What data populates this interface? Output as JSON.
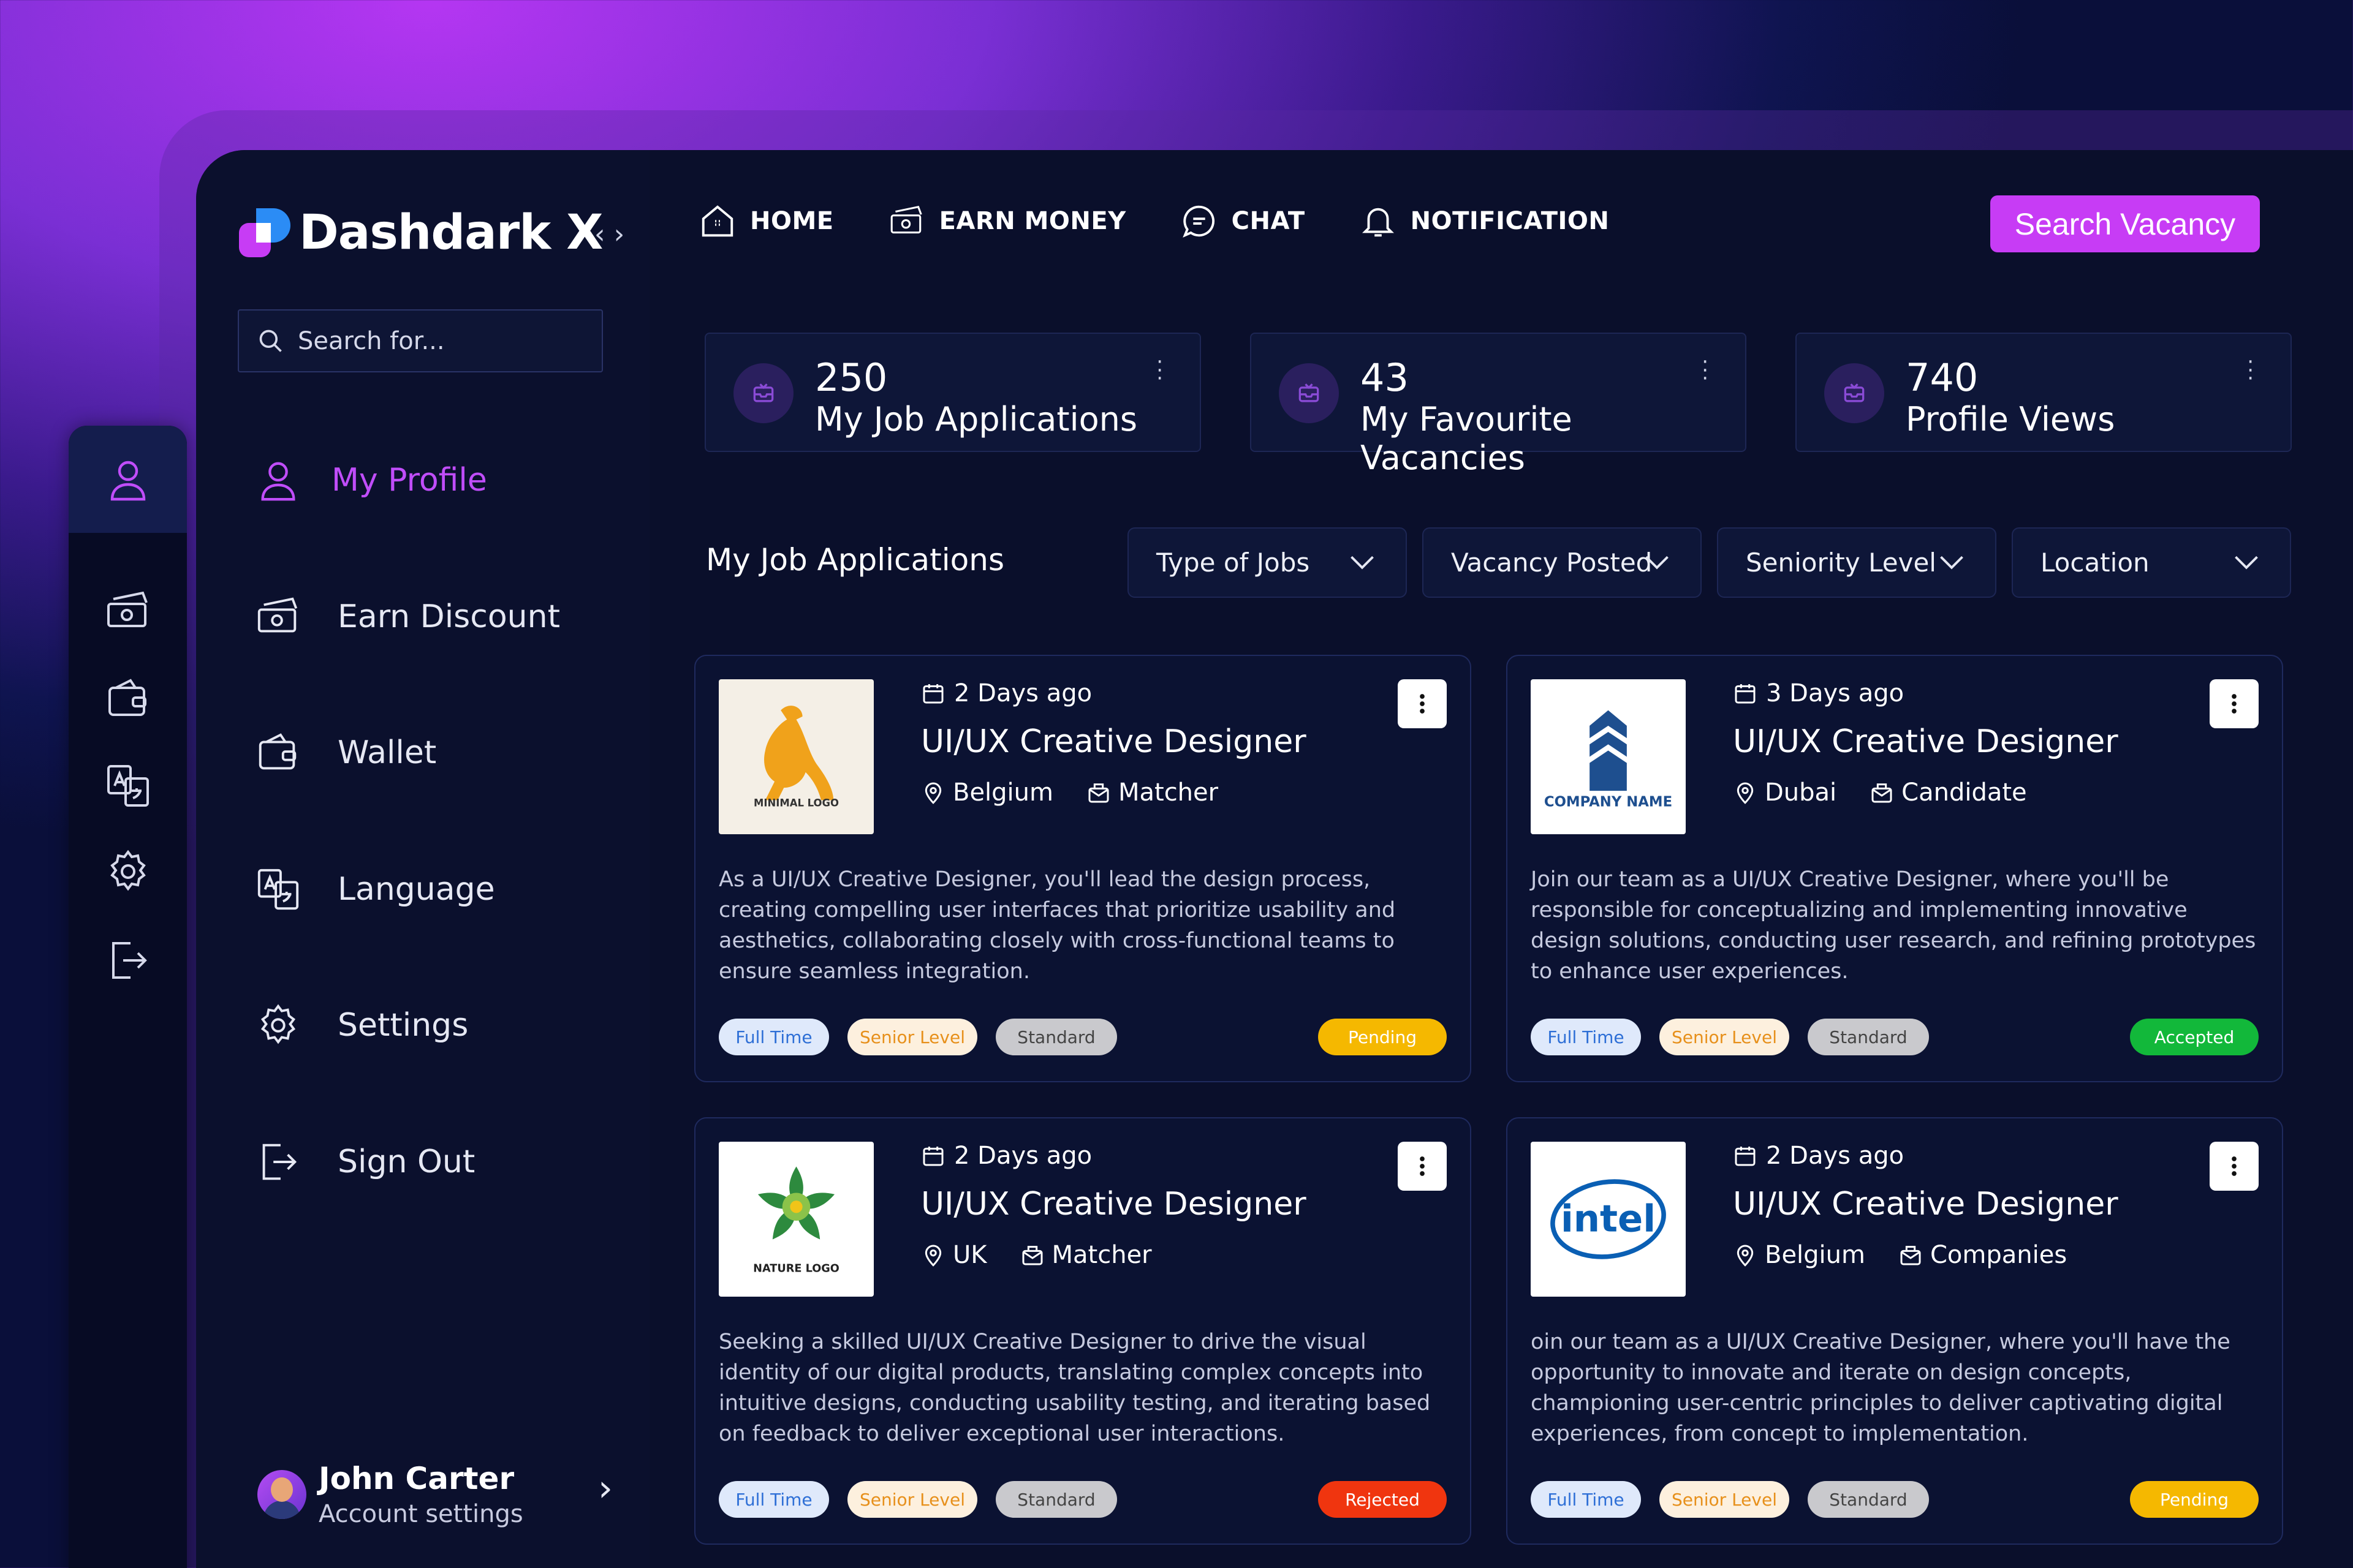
{
  "brand": {
    "name": "Dashdark X",
    "collapse_icon": "code-brackets-icon"
  },
  "search": {
    "placeholder": "Search for..."
  },
  "sidebar": {
    "items": [
      {
        "label": "My Profile",
        "icon": "user-icon",
        "active": true
      },
      {
        "label": "Earn Discount",
        "icon": "money-icon"
      },
      {
        "label": "Wallet",
        "icon": "wallet-icon"
      },
      {
        "label": "Language",
        "icon": "translate-icon"
      },
      {
        "label": "Settings",
        "icon": "gear-icon"
      },
      {
        "label": "Sign Out",
        "icon": "logout-icon"
      }
    ]
  },
  "user": {
    "name": "John Carter",
    "subtitle": "Account settings"
  },
  "topnav": {
    "items": [
      {
        "label": "HOME",
        "icon": "home-icon"
      },
      {
        "label": "EARN MONEY",
        "icon": "money-icon"
      },
      {
        "label": "CHAT",
        "icon": "chat-icon"
      },
      {
        "label": "NOTIFICATION",
        "icon": "bell-icon"
      }
    ],
    "cta": "Search Vacancy"
  },
  "stats": [
    {
      "value": "250",
      "label": "My Job Applications"
    },
    {
      "value": "43",
      "label": "My Favourite Vacancies"
    },
    {
      "value": "740",
      "label": "Profile Views"
    }
  ],
  "section": {
    "title": "My Job Applications"
  },
  "filters": [
    "Type of Jobs",
    "Vacancy Posted",
    "Seniority Level",
    "Location"
  ],
  "jobs": [
    {
      "date": "2 Days ago",
      "title": "UI/UX Creative Designer",
      "location": "Belgium",
      "type": "Matcher",
      "logo_text": "MINIMAL LOGO",
      "description": "As a UI/UX Creative Designer, you'll lead the design process, creating compelling user interfaces that prioritize usability and aesthetics, collaborating closely with cross-functional teams to ensure seamless integration.",
      "tags": [
        "Full Time",
        "Senior Level",
        "Standard"
      ],
      "status": "Pending",
      "status_color": "#f5b800"
    },
    {
      "date": "3 Days ago",
      "title": "UI/UX Creative Designer",
      "location": "Dubai",
      "type": "Candidate",
      "logo_text": "COMPANY NAME",
      "description": "Join our team as a UI/UX Creative Designer, where you'll be responsible for conceptualizing and implementing innovative design solutions, conducting user research, and refining prototypes to enhance user experiences.",
      "tags": [
        "Full Time",
        "Senior Level",
        "Standard"
      ],
      "status": "Accepted",
      "status_color": "#12b83a"
    },
    {
      "date": "2 Days ago",
      "title": "UI/UX Creative Designer",
      "location": "UK",
      "type": "Matcher",
      "logo_text": "NATURE LOGO",
      "description": "Seeking a skilled UI/UX Creative Designer to drive the visual identity of our digital products, translating complex concepts into intuitive designs, conducting usability testing, and iterating based on feedback to deliver exceptional user interactions.",
      "tags": [
        "Full Time",
        "Senior Level",
        "Standard"
      ],
      "status": "Rejected",
      "status_color": "#f0350f"
    },
    {
      "date": "2 Days ago",
      "title": "UI/UX Creative Designer",
      "location": "Belgium",
      "type": "Companies",
      "logo_text": "intel",
      "description": "oin our team as a UI/UX Creative Designer, where you'll have the opportunity to innovate and iterate on design concepts, championing user-centric principles to deliver captivating digital experiences, from concept to implementation.",
      "tags": [
        "Full Time",
        "Senior Level",
        "Standard"
      ],
      "status": "Pending",
      "status_color": "#f5b800"
    }
  ],
  "colors": {
    "accent": "#c73cf5",
    "background": "#0a0f2b",
    "panel": "#0e1638"
  }
}
